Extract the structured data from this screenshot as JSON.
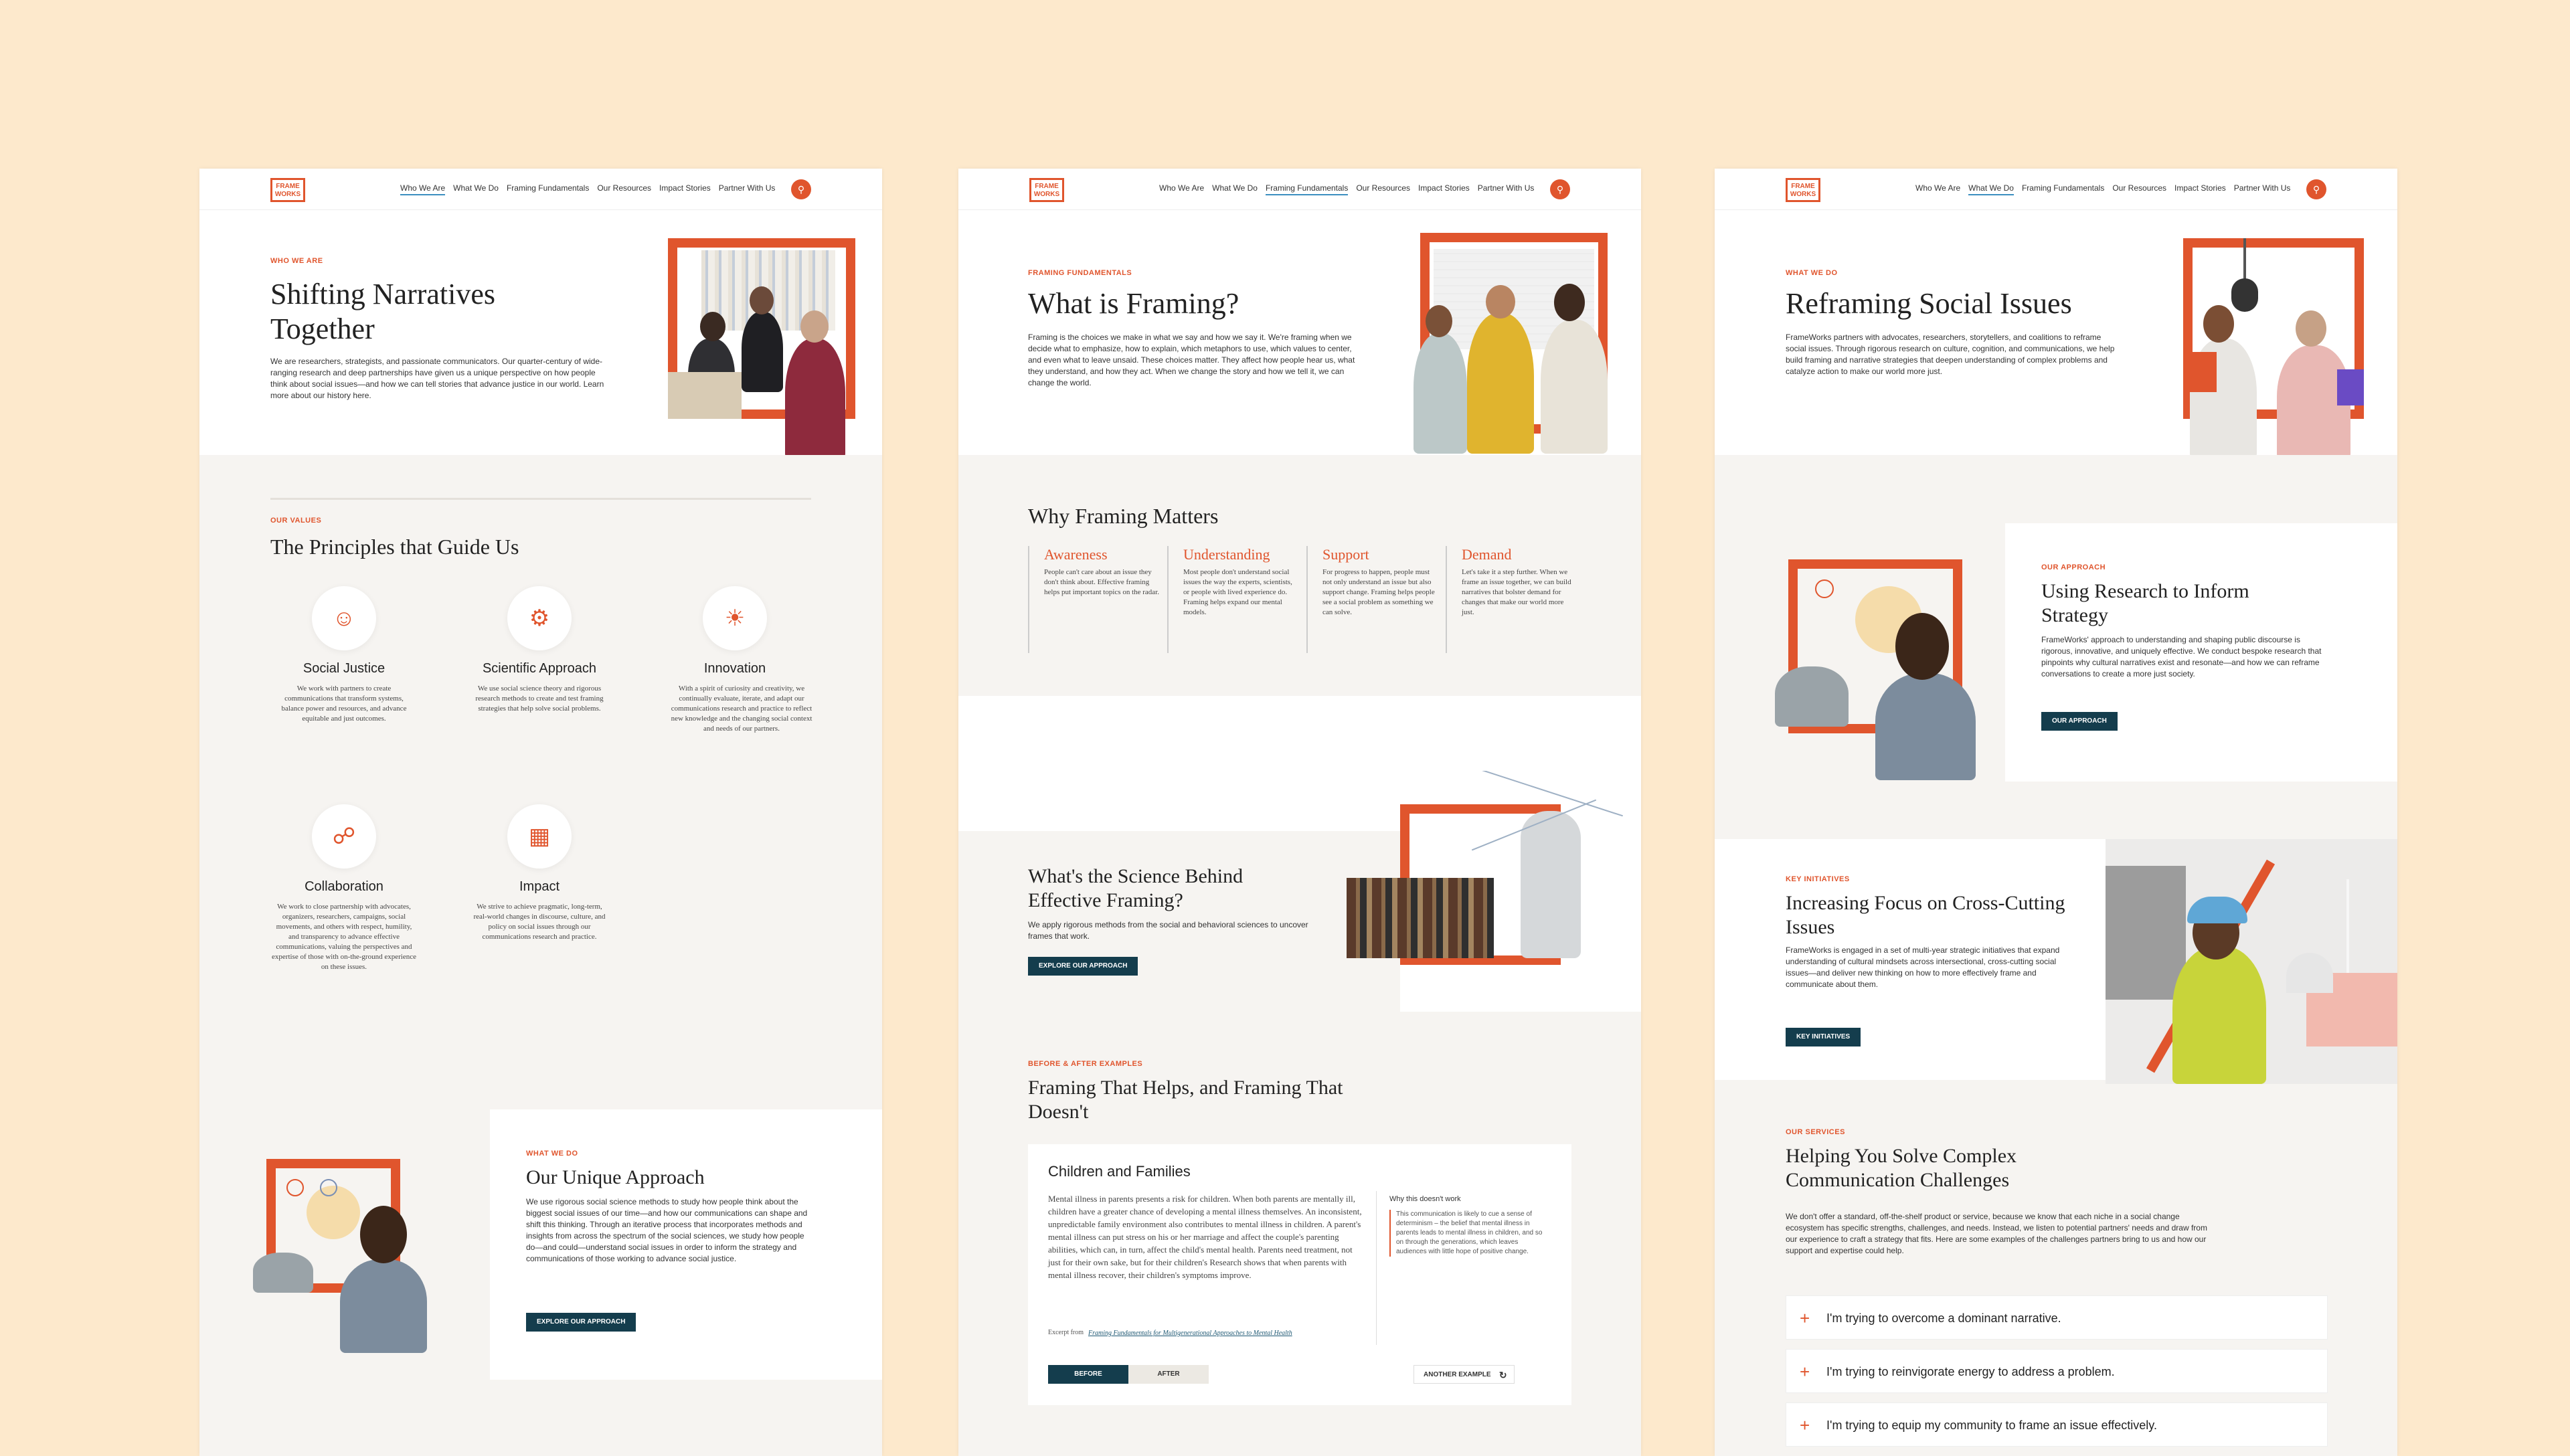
{
  "nav": {
    "logo": "FRAME\nWORKS",
    "links": [
      "Who We Are",
      "What We Do",
      "Framing Fundamentals",
      "Our Resources",
      "Impact Stories",
      "Partner With Us"
    ],
    "search_icon": "search-icon"
  },
  "page1": {
    "eyebrow": "WHO WE ARE",
    "title": "Shifting Narratives Together",
    "intro": "We are researchers, strategists, and passionate communicators. Our quarter-century of wide-ranging research and deep partnerships have given us a unique perspective on how people think about social issues—and how we can tell stories that advance justice in our world. Learn more about our history here.",
    "values_eyebrow": "OUR VALUES",
    "values_title": "The Principles that Guide Us",
    "principles": [
      {
        "title": "Social Justice",
        "text": "We work with partners to create communications that transform systems, balance power and resources, and advance equitable and just outcomes."
      },
      {
        "title": "Scientific Approach",
        "text": "We use social science theory and rigorous research methods to create and test framing strategies that help solve social problems."
      },
      {
        "title": "Innovation",
        "text": "With a spirit of curiosity and creativity, we continually evaluate, iterate, and adapt our communications research and practice to reflect new knowledge and the changing social context and needs of our partners."
      },
      {
        "title": "Collaboration",
        "text": "We work to close partnership with advocates, organizers, researchers, campaigns, social movements, and others with respect, humility, and transparency to advance effective communications, valuing the perspectives and expertise of those with on-the-ground experience on these issues."
      },
      {
        "title": "Impact",
        "text": "We strive to achieve pragmatic, long-term, real-world changes in discourse, culture, and policy on social issues through our communications research and practice."
      }
    ],
    "approach_eyebrow": "WHAT WE DO",
    "approach_title": "Our Unique Approach",
    "approach_text": "We use rigorous social science methods to study how people think about the biggest social issues of our time—and how our communications can shape and shift this thinking. Through an iterative process that incorporates methods and insights from across the spectrum of the social sciences, we study how people do—and could—understand social issues in order to inform the strategy and communications of those working to advance social justice.",
    "approach_btn": "EXPLORE OUR APPROACH"
  },
  "page2": {
    "eyebrow": "FRAMING FUNDAMENTALS",
    "title": "What is Framing?",
    "intro": "Framing is the choices we make in what we say and how we say it. We're framing when we decide what to emphasize, how to explain, which metaphors to use, which values to center, and even what to leave unsaid. These choices matter. They affect how people hear us, what they understand, and how they act. When we change the story and how we tell it, we can change the world.",
    "why_title": "Why Framing Matters",
    "columns": [
      {
        "title": "Awareness",
        "text": "People can't care about an issue they don't think about. Effective framing helps put important topics on the radar."
      },
      {
        "title": "Understanding",
        "text": "Most people don't understand social issues the way the experts, scientists, or people with lived experience do. Framing helps expand our mental models."
      },
      {
        "title": "Support",
        "text": "For progress to happen, people must not only understand an issue but also support change. Framing helps people see a social problem as something we can solve."
      },
      {
        "title": "Demand",
        "text": "Let's take it a step further. When we frame an issue together, we can build narratives that bolster demand for changes that make our world more just."
      }
    ],
    "science_title": "What's the Science Behind Effective Framing?",
    "science_text": "We apply rigorous methods from the social and behavioral sciences to uncover frames that work.",
    "science_btn": "EXPLORE OUR APPROACH",
    "ba_eyebrow": "BEFORE & AFTER EXAMPLES",
    "ba_title": "Framing That Helps, and Framing That Doesn't",
    "card_title": "Children and Families",
    "card_text": "Mental illness in parents presents a risk for children. When both parents are mentally ill, children have a greater chance of developing a mental illness themselves. An inconsistent, unpredictable family environment also contributes to mental illness in children. A parent's mental illness can put stress on his or her marriage and affect the couple's parenting abilities, which can, in turn, affect the child's mental health. Parents need treatment, not just for their own sake, but for their children's Research shows that when parents with mental illness recover, their children's symptoms improve.",
    "card_excerpt_label": "Excerpt from",
    "card_excerpt_link": "Framing Fundamentals for Multigenerational Approaches to Mental Health",
    "why_not_title": "Why this doesn't work",
    "why_not_text": "This communication is likely to cue a sense of determinism – the belief that mental illness in parents leads to mental illness in children, and so on through the generations, which leaves audiences with little hope of positive change.",
    "btn_before": "BEFORE",
    "btn_after": "AFTER",
    "btn_another": "ANOTHER EXAMPLE"
  },
  "page3": {
    "eyebrow": "WHAT WE DO",
    "title": "Reframing Social Issues",
    "intro": "FrameWorks partners with advocates, researchers, storytellers, and coalitions to reframe social issues. Through rigorous research on culture, cognition, and communications, we help build framing and narrative strategies that deepen understanding of complex problems and catalyze action to make our world more just.",
    "approach_eyebrow": "OUR APPROACH",
    "approach_title": "Using Research to Inform Strategy",
    "approach_text": "FrameWorks' approach to understanding and shaping public discourse is rigorous, innovative, and uniquely effective. We conduct bespoke research that pinpoints why cultural narratives exist and resonate—and how we can reframe conversations to create a more just society.",
    "approach_btn": "OUR APPROACH",
    "init_eyebrow": "KEY INITIATIVES",
    "init_title": "Increasing Focus on Cross-Cutting Issues",
    "init_text": "FrameWorks is engaged in a set of multi-year strategic initiatives that expand understanding of cultural mindsets across intersectional, cross-cutting social issues—and deliver new thinking on how to more effectively frame and communicate about them.",
    "init_btn": "KEY INITIATIVES",
    "services_eyebrow": "OUR SERVICES",
    "services_title": "Helping You Solve Complex Communication Challenges",
    "services_text": "We don't offer a standard, off-the-shelf product or service, because we know that each niche in a social change ecosystem has specific strengths, challenges, and needs. Instead, we listen to potential partners' needs and draw from our experience to craft a strategy that fits. Here are some examples of the challenges partners bring to us and how our support and expertise could help.",
    "accordion": [
      "I'm trying to overcome a dominant narrative.",
      "I'm trying to reinvigorate energy to address a problem.",
      "I'm trying to equip my community to frame an issue effectively."
    ]
  },
  "colors": {
    "accent": "#e0552d",
    "dark_button": "#143d4d",
    "background": "#fde9cc",
    "link_underline": "#3c8fc0"
  }
}
